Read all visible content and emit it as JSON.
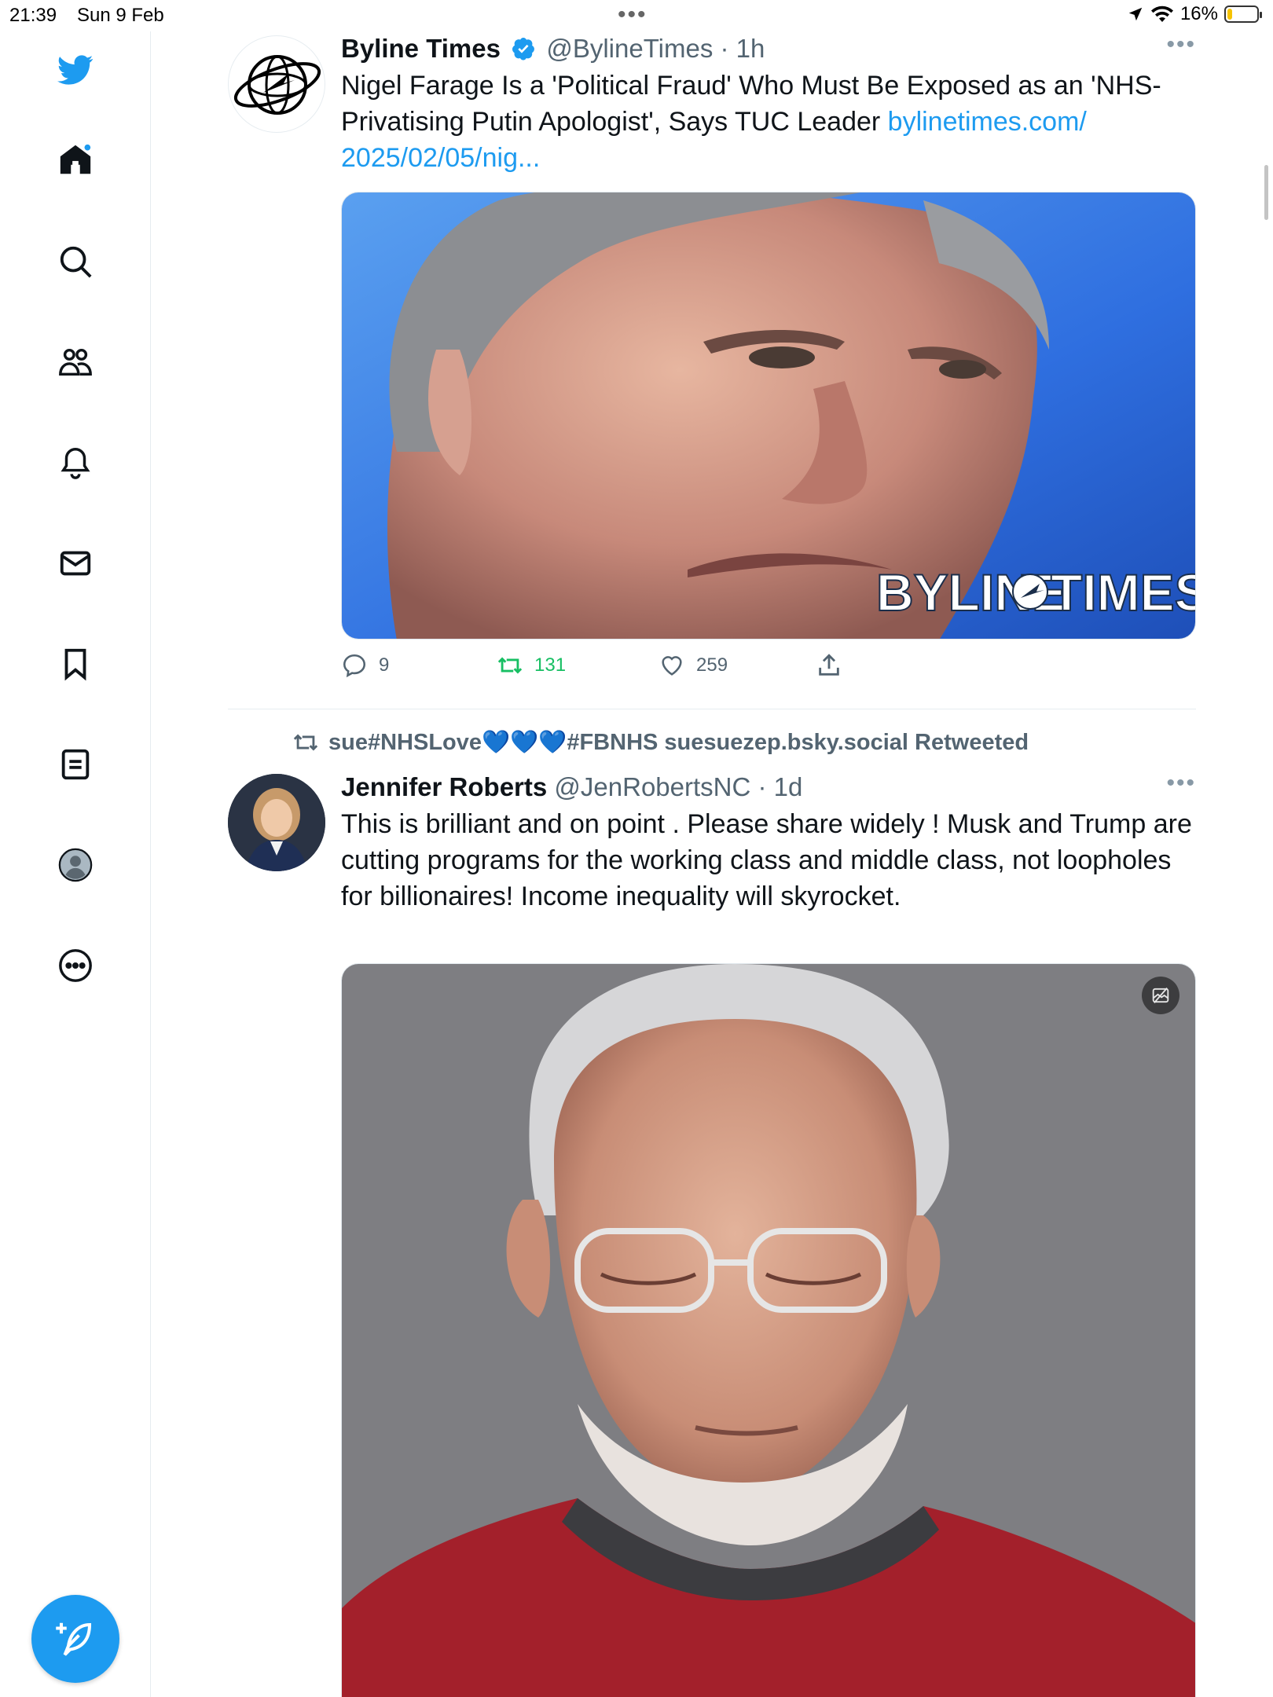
{
  "status_bar": {
    "time": "21:39",
    "date": "Sun 9 Feb",
    "battery": "16%",
    "battery_level": 0.16
  },
  "sidebar": {
    "items": [
      {
        "name": "home"
      },
      {
        "name": "explore"
      },
      {
        "name": "communities"
      },
      {
        "name": "notifications"
      },
      {
        "name": "messages"
      },
      {
        "name": "bookmarks"
      },
      {
        "name": "lists"
      },
      {
        "name": "profile"
      },
      {
        "name": "more"
      }
    ],
    "accent": "#1d9bf0"
  },
  "tweets": [
    {
      "name": "Byline Times",
      "handle": "@BylineTimes",
      "time": "· 1h",
      "text": "Nigel Farage Is a 'Political Fraud' Who Must Be Exposed as an 'NHS-Privatising Putin Apologist', Says TUC Leader ",
      "link": "bylinetimes.com/ 2025/02/05/nig...",
      "media_watermark": "BYLINE",
      "media_watermark2": "TIMES",
      "replies": "9",
      "retweets": "131",
      "likes": "259"
    },
    {
      "retweeted_by": "sue#NHSLove💙💙💙#FBNHS suesuezep.bsky.social Retweeted",
      "name": "Jennifer Roberts",
      "handle": "@JenRobertsNC",
      "time": "· 1d",
      "text": "This is brilliant and on point . Please share widely ! Musk and Trump are cutting programs for the working class and middle class, not loopholes for billionaires! Income inequality will skyrocket."
    }
  ]
}
